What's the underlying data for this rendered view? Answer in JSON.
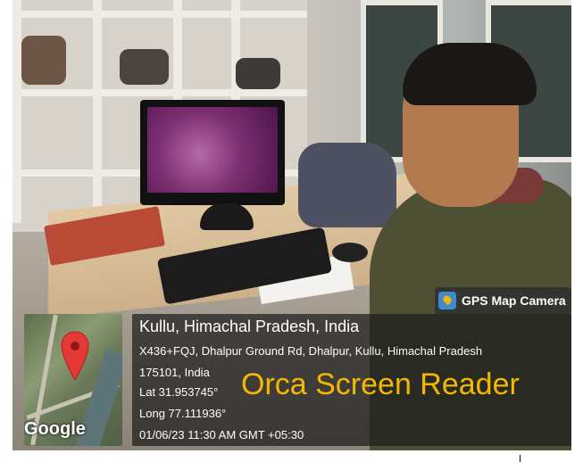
{
  "watermark_badge": {
    "label": "GPS Map Camera",
    "icon": "map-pin-app-icon",
    "accent_color": "#3f8ad1"
  },
  "map_thumbnail": {
    "provider_label": "Google",
    "pin_icon": "map-pin-icon",
    "pin_color": "#e53935"
  },
  "location": {
    "title": "Kullu, Himachal Pradesh, India",
    "address_line1": "X436+FQJ, Dhalpur Ground Rd, Dhalpur, Kullu, Himachal Pradesh",
    "address_line2": "175101, India",
    "latitude": "Lat 31.953745°",
    "longitude": "Long 77.111936°",
    "timestamp": "01/06/23 11:30 AM GMT +05:30"
  },
  "caption": {
    "text": "Orca Screen Reader",
    "color": "#f5b800"
  }
}
